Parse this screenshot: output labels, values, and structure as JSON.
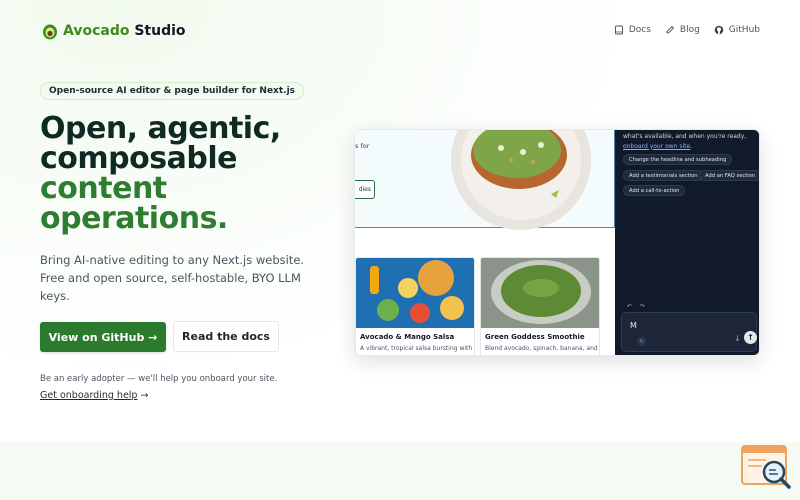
{
  "header": {
    "brand_part1": "Avocado",
    "brand_part2": "Studio",
    "nav": [
      {
        "label": "Docs",
        "icon": "book-icon"
      },
      {
        "label": "Blog",
        "icon": "pencil-icon"
      },
      {
        "label": "GitHub",
        "icon": "github-icon"
      }
    ]
  },
  "hero": {
    "badge": "Open-source AI editor & page builder for Next.js",
    "headline_line1": "Open, agentic,",
    "headline_line2": "composable",
    "headline_line3": "content",
    "headline_line4": "operations.",
    "description": "Bring AI-native editing to any Next.js website. Free and open source, self-hostable, BYO LLM keys.",
    "primary_button": "View on GitHub →",
    "secondary_button": "Read the docs",
    "early_adopter": "Be an early adopter — we'll help you onboard your site.",
    "onboarding_link": "Get onboarding help",
    "onboarding_arrow": "→"
  },
  "preview": {
    "hero_text": "s for",
    "hero_button": "dies",
    "cards": [
      {
        "title": "Avocado & Mango Salsa",
        "text": "A vibrant, tropical salsa bursting with"
      },
      {
        "title": "Green Goddess Smoothie",
        "text": "Blend avocado, spinach, banana, and"
      }
    ],
    "assistant": {
      "message_start": "what's available, and when you're ready,",
      "message_link": "onboard your own site",
      "message_end": ".",
      "suggestions": [
        "Change the headline and subheading",
        "Add a testimonials section",
        "Add an FAQ section",
        "Add a call-to-action"
      ],
      "input_value": "M",
      "undo_symbol": "↶",
      "redo_symbol": "↷",
      "send_symbol": "↑",
      "mic_symbol": "↓",
      "tool_symbol": "✎"
    }
  },
  "colors": {
    "brand_green": "#3f8a1c",
    "button_green": "#2b7a2e",
    "panel_bg": "#111a2b"
  }
}
